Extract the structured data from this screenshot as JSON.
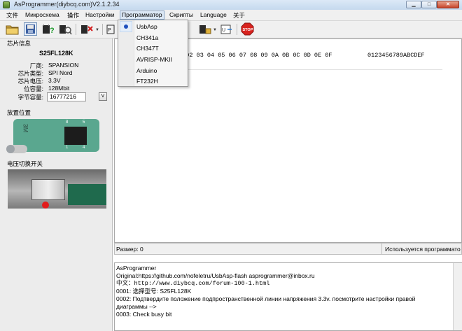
{
  "window": {
    "title": "AsProgrammer(diybcq.com)V2.1.2.34"
  },
  "menu": [
    "文件",
    "Микросхема",
    "操作",
    "Настройки",
    "Программатор",
    "Скрипты",
    "Language",
    "关于"
  ],
  "programmer_menu": {
    "items": [
      "UsbAsp",
      "CH341a",
      "CH347T",
      "AVRISP-MKII",
      "Arduino",
      "FT232H"
    ],
    "selected": "UsbAsp"
  },
  "chip_info": {
    "section_title": "芯片信息",
    "chip_name": "S25FL128K",
    "rows": [
      {
        "label": "厂商:",
        "value": "SPANSION"
      },
      {
        "label": "芯片类型:",
        "value": "SPI Nord"
      },
      {
        "label": "芯片电压:",
        "value": "3.3V"
      },
      {
        "label": "位容量:",
        "value": "128Mbit"
      }
    ],
    "bytes_label": "字节容量:",
    "bytes_value": "16777216",
    "v_button": "V"
  },
  "placement": {
    "section_title": "放置位置",
    "socket_label": "3M",
    "pin_labels": [
      "8",
      "5",
      "1",
      "4"
    ]
  },
  "voltage_switch": {
    "section_title": "电压切换开关"
  },
  "hex": {
    "header_offsets": "01 02 03 04 05 06 07  08 09 0A 0B 0C 0D 0E 0F",
    "header_ascii": "0123456789ABCDEF"
  },
  "status": {
    "size": "Размер: 0",
    "programmer": "Используется программатор"
  },
  "log": [
    "AsProgrammer",
    "Original:https://github.com/nofeletru/UsbAsp-flash asprogrammer@inbox.ru",
    "中文：http://www.diybcq.com/forum-100-1.html",
    "0001: 选择型号: S25FL128K",
    "0002: Подтвердите положение подпространственной линии напряжения 3.3v. посмотрите настройки правой",
    "диаграммы -->",
    "0003: Check busy bit"
  ]
}
